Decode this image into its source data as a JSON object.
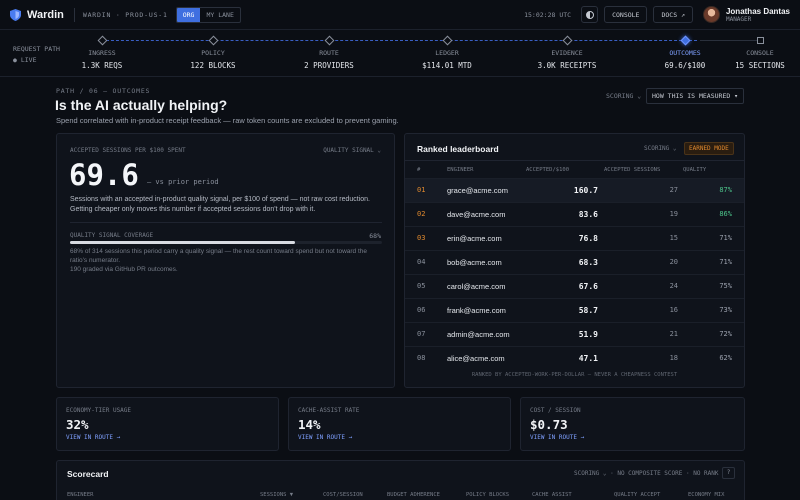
{
  "topbar": {
    "brand": "Wardin",
    "env": "WARDIN · PROD-US-1",
    "scope_tabs": [
      "ORG",
      "MY LANE"
    ],
    "clock": "15:02:28 UTC",
    "console_btn": "CONSOLE",
    "docs_btn": "DOCS ↗",
    "user_name": "Jonathas Dantas",
    "user_role": "MANAGER"
  },
  "pipeline": {
    "label": "REQUEST PATH",
    "live": "● LIVE",
    "stages": [
      {
        "name": "INGRESS",
        "value": "1.3K REQS"
      },
      {
        "name": "POLICY",
        "value": "122 BLOCKS"
      },
      {
        "name": "ROUTE",
        "value": "2 PROVIDERS"
      },
      {
        "name": "LEDGER",
        "value": "$114.01 MTD"
      },
      {
        "name": "EVIDENCE",
        "value": "3.0K RECEIPTS"
      },
      {
        "name": "OUTCOMES",
        "value": "69.6/$100"
      },
      {
        "name": "CONSOLE",
        "value": "15 SECTIONS"
      }
    ]
  },
  "page": {
    "breadcrumb": "PATH / 06 — OUTCOMES",
    "title": "Is the AI actually helping?",
    "subtitle": "Spend correlated with in-product receipt feedback — raw token counts are excluded to prevent gaming.",
    "scoring_label": "SCORING ⌄",
    "measured_btn": "HOW THIS IS MEASURED ▾"
  },
  "metric": {
    "label": "ACCEPTED SESSIONS PER $100 SPENT",
    "quality_label": "QUALITY SIGNAL ⌄",
    "value": "69.6",
    "vs": "— vs prior period",
    "description": "Sessions with an accepted in-product quality signal, per $100 of spend — not raw cost reduction. Getting cheaper only moves this number if accepted sessions don't drop with it.",
    "coverage_label": "QUALITY SIGNAL COVERAGE",
    "coverage_pct": "68%",
    "coverage_fraction": 0.72,
    "coverage_note": "68% of 314 sessions this period carry a quality signal — the rest count toward spend but not toward the ratio's numerator.",
    "graded": "190 graded via GitHub PR outcomes."
  },
  "leaderboard": {
    "title": "Ranked leaderboard",
    "scoring": "SCORING ⌄",
    "mode": "EARNED MODE",
    "headers": {
      "rank": "#",
      "engineer": "ENGINEER",
      "accepted": "ACCEPTED/$100",
      "sessions": "ACCEPTED SESSIONS",
      "quality": "QUALITY"
    },
    "rows": [
      {
        "rank": "01",
        "email": "grace@acme.com",
        "value": "160.7",
        "sessions": "27",
        "quality": "87%"
      },
      {
        "rank": "02",
        "email": "dave@acme.com",
        "value": "83.6",
        "sessions": "19",
        "quality": "86%"
      },
      {
        "rank": "03",
        "email": "erin@acme.com",
        "value": "76.8",
        "sessions": "15",
        "quality": "71%"
      },
      {
        "rank": "04",
        "email": "bob@acme.com",
        "value": "68.3",
        "sessions": "20",
        "quality": "71%"
      },
      {
        "rank": "05",
        "email": "carol@acme.com",
        "value": "67.6",
        "sessions": "24",
        "quality": "75%"
      },
      {
        "rank": "06",
        "email": "frank@acme.com",
        "value": "58.7",
        "sessions": "16",
        "quality": "73%"
      },
      {
        "rank": "07",
        "email": "admin@acme.com",
        "value": "51.9",
        "sessions": "21",
        "quality": "72%"
      },
      {
        "rank": "08",
        "email": "alice@acme.com",
        "value": "47.1",
        "sessions": "18",
        "quality": "62%"
      }
    ],
    "footer": "RANKED BY ACCEPTED-WORK-PER-DOLLAR — NEVER A CHEAPNESS CONTEST"
  },
  "cards": [
    {
      "label": "ECONOMY-TIER USAGE",
      "value": "32%",
      "link": "VIEW IN ROUTE →"
    },
    {
      "label": "CACHE-ASSIST RATE",
      "value": "14%",
      "link": "VIEW IN ROUTE →"
    },
    {
      "label": "COST / SESSION",
      "value": "$0.73",
      "link": "VIEW IN ROUTE →"
    }
  ],
  "scorecard": {
    "title": "Scorecard",
    "right": "SCORING ⌄  ·  NO COMPOSITE SCORE · NO RANK",
    "help": "?",
    "headers": [
      "ENGINEER",
      "SESSIONS ▼",
      "COST/SESSION",
      "BUDGET ADHERENCE",
      "POLICY BLOCKS",
      "CACHE ASSIST",
      "QUALITY ACCEPT",
      "ECONOMY MIX"
    ]
  },
  "colors": {
    "accent": "#3f6fe0",
    "rank_top": "#e0892e",
    "good": "#4cc38a",
    "background": "#0b0e14"
  }
}
